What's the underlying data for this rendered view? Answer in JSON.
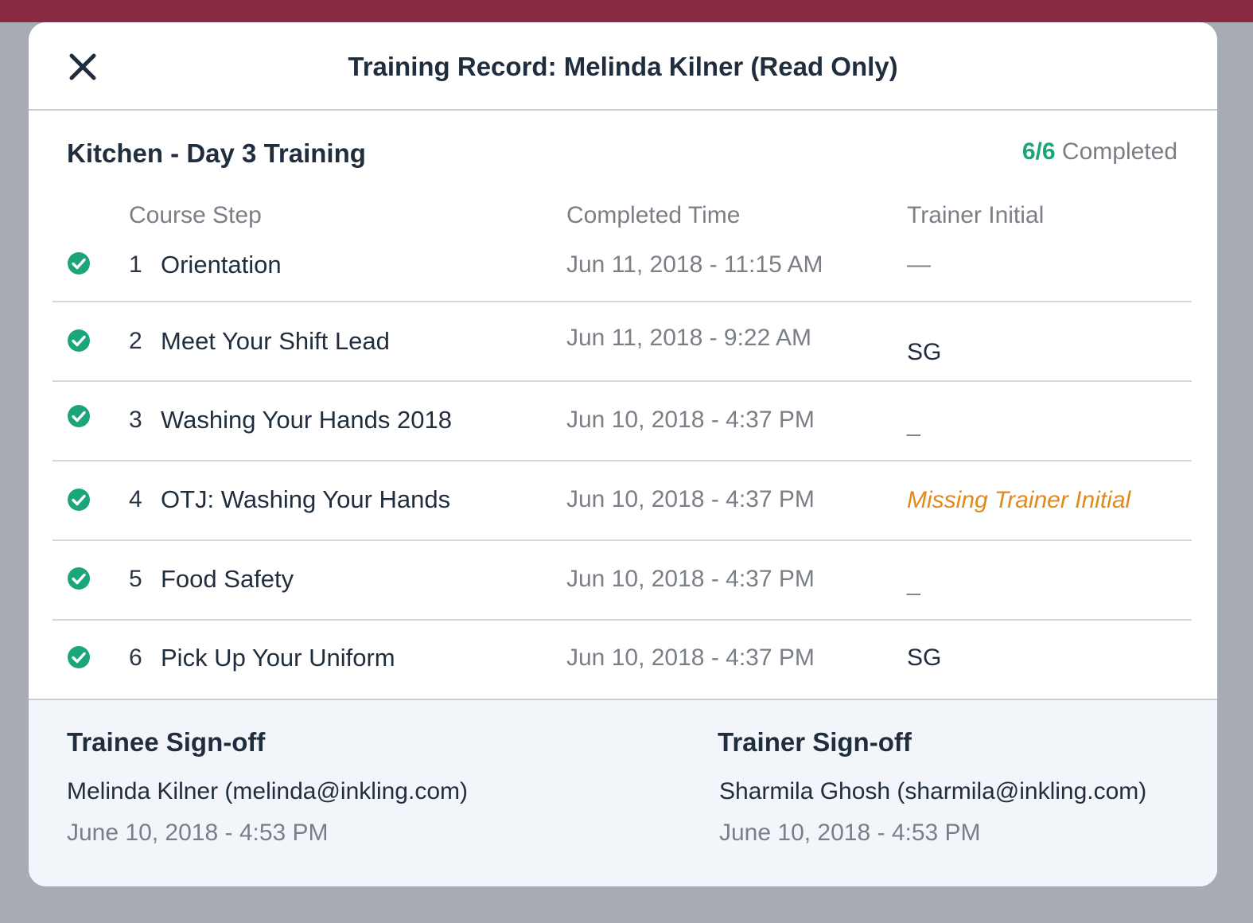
{
  "modal": {
    "title": "Training Record: Melinda Kilner (Read Only)"
  },
  "course": {
    "title": "Kitchen - Day 3 Training",
    "completed_count": "6/6",
    "completed_label": "Completed"
  },
  "columns": {
    "step": "Course Step",
    "time": "Completed Time",
    "initial": "Trainer Initial"
  },
  "steps": [
    {
      "num": "1",
      "name": "Orientation",
      "time": "Jun 11, 2018 - 11:15 AM",
      "initial": "—",
      "status": "completed"
    },
    {
      "num": "2",
      "name": "Meet Your Shift Lead",
      "time": "Jun 11, 2018 - 9:22 AM",
      "initial": "SG",
      "status": "completed"
    },
    {
      "num": "3",
      "name": "Washing Your Hands 2018",
      "time": "Jun 10, 2018 - 4:37 PM",
      "initial": "_",
      "status": "completed"
    },
    {
      "num": "4",
      "name": "OTJ: Washing Your Hands",
      "time": "Jun 10, 2018 - 4:37 PM",
      "initial": "Missing Trainer Initial",
      "status": "completed"
    },
    {
      "num": "5",
      "name": "Food Safety",
      "time": "Jun 10, 2018 - 4:37 PM",
      "initial": "_",
      "status": "completed"
    },
    {
      "num": "6",
      "name": "Pick Up Your Uniform",
      "time": "Jun 10, 2018 - 4:37 PM",
      "initial": "SG",
      "status": "completed"
    }
  ],
  "signoff": {
    "trainee": {
      "title": "Trainee Sign-off",
      "name": "Melinda Kilner (melinda@inkling.com)",
      "date": "June 10, 2018 - 4:53 PM"
    },
    "trainer": {
      "title": "Trainer Sign-off",
      "name": "Sharmila Ghosh (sharmila@inkling.com)",
      "date": "June 10, 2018 - 4:53 PM"
    }
  },
  "colors": {
    "accent_bar": "#8a2942",
    "success": "#1aa57a",
    "warning": "#e08a1a",
    "text_primary": "#1f2d3d",
    "text_muted": "#7a7f87"
  },
  "icons": {
    "close": "close-icon",
    "check": "check-circle-icon"
  }
}
